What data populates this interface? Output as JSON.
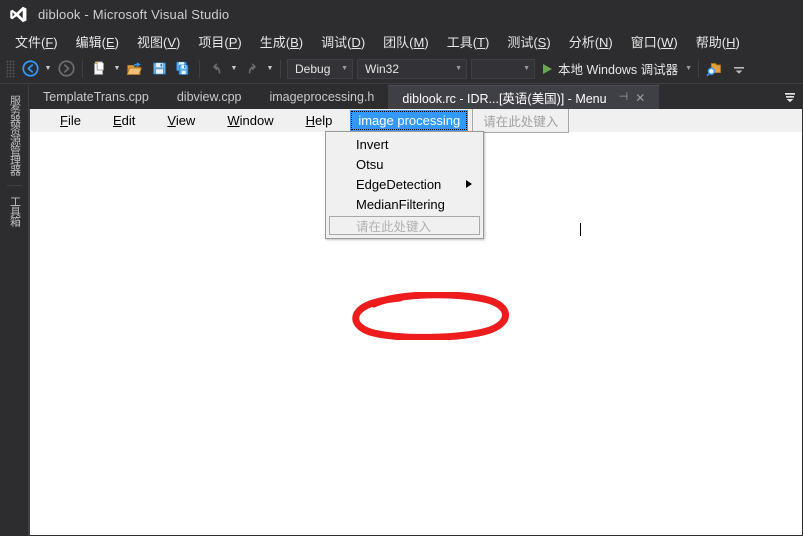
{
  "window": {
    "title": "diblook - Microsoft Visual Studio",
    "logo_icon": "visual-studio-logo-icon"
  },
  "main_menu": {
    "items": [
      {
        "label": "文件(F)",
        "pre": "文件(",
        "accel": "F",
        "post": ")"
      },
      {
        "label": "编辑(E)",
        "pre": "编辑(",
        "accel": "E",
        "post": ")"
      },
      {
        "label": "视图(V)",
        "pre": "视图(",
        "accel": "V",
        "post": ")"
      },
      {
        "label": "项目(P)",
        "pre": "项目(",
        "accel": "P",
        "post": ")"
      },
      {
        "label": "生成(B)",
        "pre": "生成(",
        "accel": "B",
        "post": ")"
      },
      {
        "label": "调试(D)",
        "pre": "调试(",
        "accel": "D",
        "post": ")"
      },
      {
        "label": "团队(M)",
        "pre": "团队(",
        "accel": "M",
        "post": ")"
      },
      {
        "label": "工具(T)",
        "pre": "工具(",
        "accel": "T",
        "post": ")"
      },
      {
        "label": "测试(S)",
        "pre": "测试(",
        "accel": "S",
        "post": ")"
      },
      {
        "label": "分析(N)",
        "pre": "分析(",
        "accel": "N",
        "post": ")"
      },
      {
        "label": "窗口(W)",
        "pre": "窗口(",
        "accel": "W",
        "post": ")"
      },
      {
        "label": "帮助(H)",
        "pre": "帮助(",
        "accel": "H",
        "post": ")"
      }
    ]
  },
  "toolbar": {
    "navigate_back_icon": "navigate-back-icon",
    "navigate_forward_icon": "navigate-forward-icon",
    "new_item_icon": "new-item-icon",
    "open_file_icon": "open-file-icon",
    "save_icon": "save-icon",
    "save_all_icon": "save-all-icon",
    "undo_icon": "undo-icon",
    "redo_icon": "redo-icon",
    "config_combo": "Debug",
    "platform_combo": "Win32",
    "empty_combo": "",
    "run_label": "本地 Windows 调试器",
    "run_play_icon": "play-icon",
    "find_in_files_icon": "find-in-files-icon",
    "toolbar_options_icon": "toolbar-options-icon",
    "accent_blue": "#3399ff",
    "play_green": "#6aa84f"
  },
  "left_dock": {
    "items": [
      {
        "label": "服务器资源管理器"
      },
      {
        "label": "工具箱"
      }
    ]
  },
  "tabs": [
    {
      "label": "TemplateTrans.cpp",
      "active": false
    },
    {
      "label": "dibview.cpp",
      "active": false
    },
    {
      "label": "imageprocessing.h",
      "active": false
    },
    {
      "label": "diblook.rc - IDR...[英语(美国)] - Menu",
      "active": true,
      "pin_icon": "pin-icon",
      "close_icon": "close-icon"
    }
  ],
  "tab_overflow_icon": "tab-overflow-icon",
  "resource_editor": {
    "menubar": [
      {
        "label": "File",
        "pre": "",
        "accel": "F",
        "post": "ile",
        "state": "normal"
      },
      {
        "label": "Edit",
        "pre": "",
        "accel": "E",
        "post": "dit",
        "state": "normal"
      },
      {
        "label": "View",
        "pre": "",
        "accel": "V",
        "post": "iew",
        "state": "normal"
      },
      {
        "label": "Window",
        "pre": "",
        "accel": "W",
        "post": "indow",
        "state": "normal"
      },
      {
        "label": "Help",
        "pre": "",
        "accel": "H",
        "post": "elp",
        "state": "normal"
      },
      {
        "label": "image processing",
        "state": "selected"
      },
      {
        "label": "请在此处键入",
        "state": "typehere"
      }
    ],
    "dropdown": {
      "items": [
        {
          "label": "Invert",
          "has_submenu": false,
          "state": "normal"
        },
        {
          "label": "Otsu",
          "has_submenu": false,
          "state": "normal"
        },
        {
          "label": "EdgeDetection",
          "has_submenu": true,
          "state": "normal",
          "submenu_arrow_icon": "submenu-arrow-icon"
        },
        {
          "label": "MedianFiltering",
          "has_submenu": false,
          "state": "normal"
        },
        {
          "label": "请在此处键入",
          "has_submenu": false,
          "state": "typehere"
        }
      ]
    }
  },
  "annotation": {
    "shape": "red-ellipse-highlight",
    "color": "#ee1c1c",
    "targets": "MedianFiltering"
  }
}
